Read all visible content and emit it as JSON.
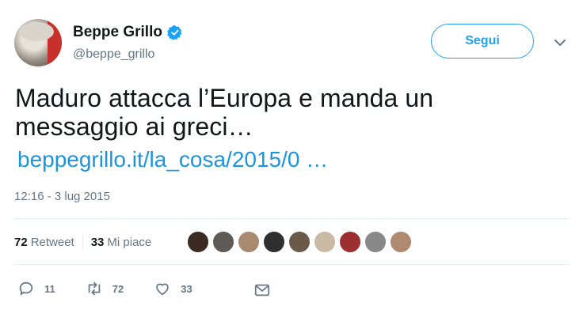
{
  "user": {
    "name": "Beppe Grillo",
    "handle": "@beppe_grillo",
    "verified": true
  },
  "follow_button": {
    "label": "Segui"
  },
  "tweet": {
    "text_line1": "Maduro attacca l’Europa e manda un",
    "text_line2": "messaggio ai greci…",
    "link": "beppegrillo.it/la_cosa/2015/0  …",
    "timestamp": "12:16 - 3 lug 2015"
  },
  "stats": {
    "retweets_count": "72",
    "retweets_label": "Retweet",
    "likes_count": "33",
    "likes_label": "Mi piace"
  },
  "likers_colors": [
    "#3a2a22",
    "#5e5a55",
    "#a88a70",
    "#2f2f2f",
    "#6b5a4a",
    "#c9b9a5",
    "#9c2f2f",
    "#888888",
    "#b08a70"
  ],
  "actions": {
    "reply_count": "11",
    "retweet_count": "72",
    "like_count": "33"
  },
  "colors": {
    "accent": "#1da1f2",
    "link": "#1b95e0",
    "muted": "#657786"
  }
}
